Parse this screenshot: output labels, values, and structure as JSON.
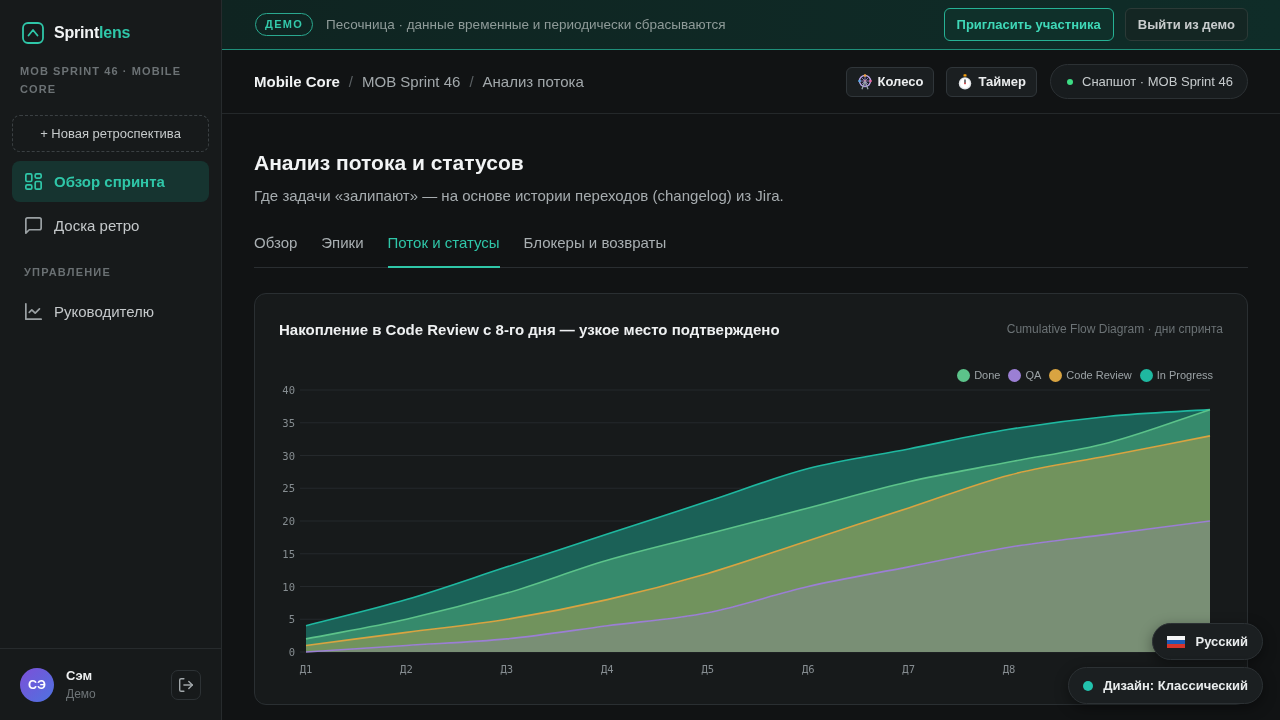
{
  "sidebar": {
    "brand": {
      "main": "Sprint",
      "accent": "lens"
    },
    "sprint_label": "MOB SPRINT 46 · MOBILE CORE",
    "new_retro_button": "+ Новая ретроспектива",
    "nav": [
      {
        "label": "Обзор спринта",
        "selected": true
      },
      {
        "label": "Доска ретро",
        "selected": false
      }
    ],
    "sections": [
      {
        "title": "УПРАВЛЕНИЕ",
        "items": [
          {
            "label": "Руководителю",
            "selected": false
          }
        ]
      }
    ],
    "user": {
      "initials": "СЭ",
      "name": "Сэм",
      "role": "Демо"
    }
  },
  "demo_banner": {
    "badge": "ДЕМО",
    "message": "Песочница · данные временные и периодически сбрасываются",
    "buttons": [
      {
        "label": "Пригласить участника",
        "kind": "primary"
      },
      {
        "label": "Выйти из демо",
        "kind": "secondary"
      }
    ]
  },
  "header": {
    "breadcrumb": [
      {
        "label": "Mobile Core"
      },
      {
        "separator": "/",
        "label": "MOB Sprint 46"
      },
      {
        "separator": "/",
        "label": "Анализ потока"
      }
    ],
    "actions": [
      {
        "label": "Колесо"
      },
      {
        "label": "Таймер"
      }
    ],
    "snapshot": "Снапшот · MOB Sprint 46"
  },
  "page": {
    "title": "Анализ потока и статусов",
    "subtitle": "Где задачи «залипают» — на основе истории переходов (changelog) из Jira.",
    "tabs": [
      {
        "label": "Обзор",
        "selected": false
      },
      {
        "label": "Эпики",
        "selected": false
      },
      {
        "label": "Поток и статусы",
        "selected": true
      },
      {
        "label": "Блокеры и возвраты",
        "selected": false
      }
    ],
    "chart_card": {
      "title": "Накопление в Code Review с 8-го дня — узкое место подтверждено",
      "caption": "Cumulative Flow Diagram · дни спринта",
      "chart_data": {
        "type": "area",
        "stacked": false,
        "grid": true,
        "legend": true,
        "categories": [
          "Д1",
          "Д2",
          "Д3",
          "Д4",
          "Д5",
          "Д6",
          "Д7",
          "Д8",
          null,
          null
        ],
        "ylim": [
          0,
          40
        ],
        "yticks": [
          0,
          5,
          10,
          15,
          20,
          25,
          30,
          35,
          40
        ],
        "series": [
          {
            "name": "Done",
            "color": "#5cc38a",
            "values": [
              2,
              5,
              9,
              14,
              18,
              22,
              26,
              29,
              32,
              37
            ]
          },
          {
            "name": "QA",
            "color": "#9b7fd4",
            "values": [
              0,
              1,
              2,
              4,
              6,
              10,
              13,
              16,
              18,
              20
            ]
          },
          {
            "name": "Code Review",
            "color": "#d9a441",
            "values": [
              1,
              3,
              5,
              8,
              12,
              17,
              22,
              27,
              30,
              33
            ]
          },
          {
            "name": "In Progress",
            "color": "#1fb8a0",
            "values": [
              4,
              8,
              13,
              18,
              23,
              28,
              31,
              34,
              36,
              37
            ]
          }
        ]
      }
    }
  },
  "floating_controls": {
    "language": "Русский",
    "theme": "Дизайн: Классический"
  }
}
